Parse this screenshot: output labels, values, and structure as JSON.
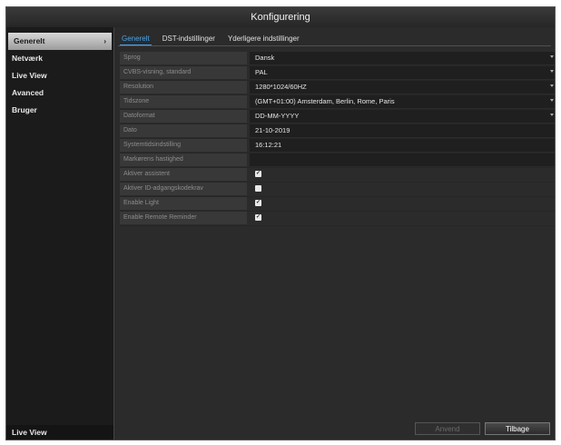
{
  "window": {
    "title": "Konfigurering"
  },
  "sidebar": {
    "items": [
      {
        "label": "Generelt",
        "active": true
      },
      {
        "label": "Netværk"
      },
      {
        "label": "Live View"
      },
      {
        "label": "Avanced"
      },
      {
        "label": "Bruger"
      }
    ],
    "chevron": "›",
    "bottom_label": "Live View"
  },
  "tabs": [
    {
      "label": "Generelt",
      "active": true
    },
    {
      "label": "DST-indstillinger"
    },
    {
      "label": "Yderligere indstillinger"
    }
  ],
  "settings": [
    {
      "label": "Sprog",
      "value": "Dansk",
      "control": "dropdown"
    },
    {
      "label": "CVBS-visning, standard",
      "value": "PAL",
      "control": "dropdown"
    },
    {
      "label": "Resolution",
      "value": "1280*1024/60HZ",
      "control": "dropdown"
    },
    {
      "label": "Tidszone",
      "value": "(GMT+01:00) Amsterdam, Berlin, Rome, Paris",
      "control": "dropdown"
    },
    {
      "label": "Datoformat",
      "value": "DD-MM-YYYY",
      "control": "dropdown"
    },
    {
      "label": "Dato",
      "value": "21-10-2019",
      "control": "spin"
    },
    {
      "label": "Systemtidsindstilling",
      "value": "16:12:21",
      "control": "spin"
    },
    {
      "label": "Markørens hastighed",
      "value": "",
      "control": "slider"
    },
    {
      "label": "Aktiver assistent",
      "value": "",
      "control": "checkbox",
      "checked": true
    },
    {
      "label": "Aktiver ID-adgangskodekrav",
      "value": "",
      "control": "checkbox",
      "checked": false
    },
    {
      "label": "Enable Light",
      "value": "",
      "control": "checkbox",
      "checked": true
    },
    {
      "label": "Enable Remote Reminder",
      "value": "",
      "control": "checkbox",
      "checked": true
    }
  ],
  "buttons": {
    "apply_label": "Anvend",
    "back_label": "Tilbage"
  },
  "icons": {
    "dropdown": "caret-down-icon",
    "spin": "spinner-icon",
    "checkbox": "checkbox-icon"
  },
  "colors": {
    "accent": "#4aa3e8",
    "background": "#2b2b2b",
    "sidebar": "#1b1b1b"
  }
}
